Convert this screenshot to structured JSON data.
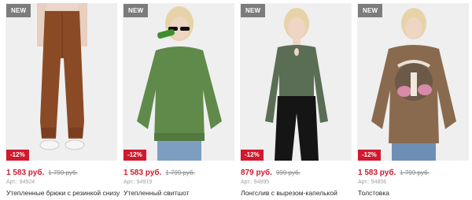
{
  "products": [
    {
      "badge": "NEW",
      "discount": "-12%",
      "price": "1 583 руб.",
      "old_price": "1 799 руб.",
      "sku": "Арт.: 94924",
      "name": "Утепленные брюки с резинкой снизу",
      "garment_color": "#8b4a26"
    },
    {
      "badge": "NEW",
      "discount": "-12%",
      "price": "1 583 руб.",
      "old_price": "1 799 руб.",
      "sku": "Арт.: 94919",
      "name": "Утепленный свитшот",
      "garment_color": "#5f8a4a"
    },
    {
      "badge": "NEW",
      "discount": "-12%",
      "price": "879 руб.",
      "old_price": "999 руб.",
      "sku": "Арт.: 94895",
      "name": "Лонгслив с вырезом-капелькой",
      "garment_color": "#5a6e55"
    },
    {
      "badge": "NEW",
      "discount": "-12%",
      "price": "1 583 руб.",
      "old_price": "1 799 руб.",
      "sku": "Арт.: 94856",
      "name": "Толстовка",
      "garment_color": "#8a6a4e"
    }
  ],
  "colors": {
    "accent_red": "#d0192e",
    "badge_grey": "#7c7c7c"
  }
}
